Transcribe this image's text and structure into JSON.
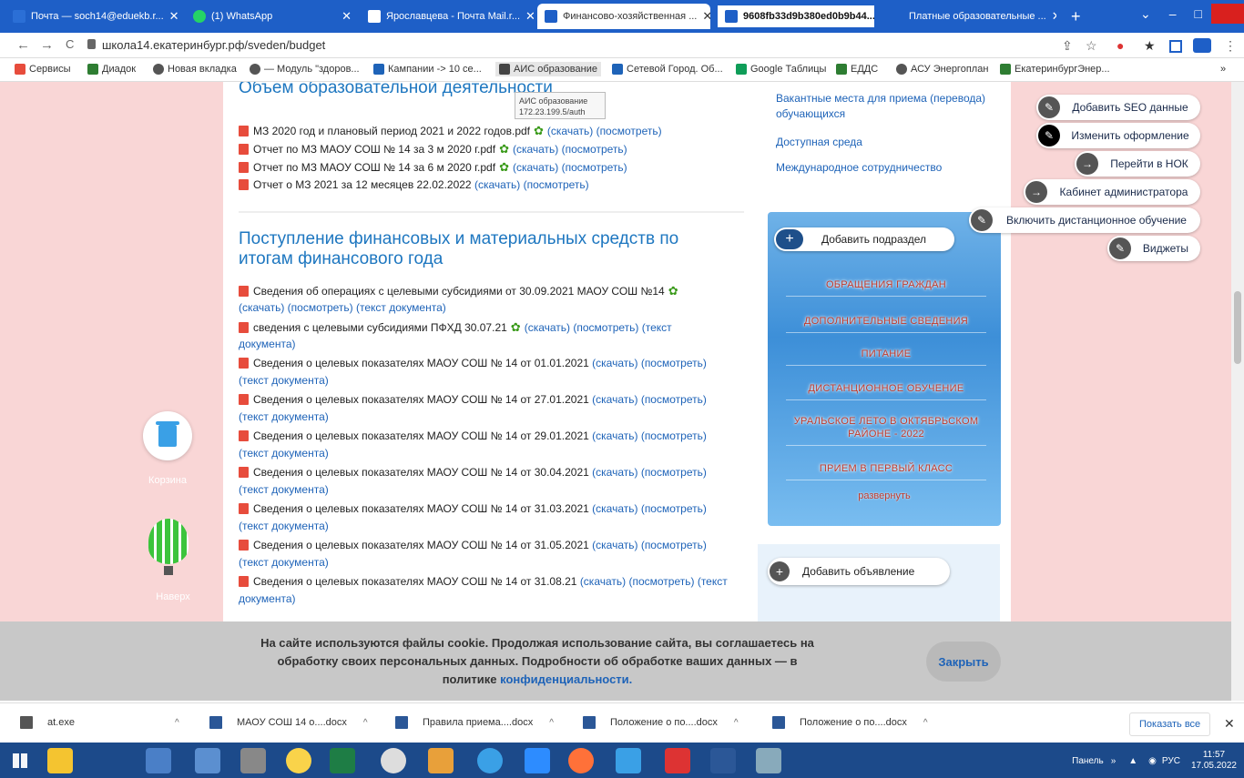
{
  "tabs": [
    {
      "title": "Почта — soch14@eduekb.r...",
      "icon_color": "#2b6fd6"
    },
    {
      "title": "(1) WhatsApp",
      "icon_color": "#25d366"
    },
    {
      "title": "Ярославцева - Почта Mail.r...",
      "icon_color": "#1e5fc7"
    },
    {
      "title": "Финансово-хозяйственная ...",
      "icon_color": "#1e5fc7"
    },
    {
      "title": "9608fb33d9b380ed0b9b44...",
      "icon_color": "#1e5fc7"
    },
    {
      "title": "Платные образовательные ...",
      "icon_color": "#1e5fc7"
    }
  ],
  "window": {
    "new_tab": "+",
    "minimize": "–",
    "maximize": "□",
    "dropdown": "⌄"
  },
  "address": {
    "url": "школа14.екатеринбург.рф/sveden/budget",
    "back": "←",
    "forward": "→",
    "reload": "C",
    "share": "⇪",
    "star": "☆",
    "ext": "★"
  },
  "bookmarks": [
    {
      "label": "Сервисы",
      "color": "#e74c3c"
    },
    {
      "label": "Диадок",
      "color": "#2e7d32"
    },
    {
      "label": "Новая вкладка",
      "color": "#555"
    },
    {
      "label": "— Модуль \"здоров...",
      "color": "#555"
    },
    {
      "label": "Кампании -> 10 се...",
      "color": "#1e63b8"
    },
    {
      "label": "АИС образование",
      "color": "#444"
    },
    {
      "label": "Сетевой Город. Об...",
      "color": "#1e63b8"
    },
    {
      "label": "Google Таблицы",
      "color": "#0f9d58"
    },
    {
      "label": "ЕДДС",
      "color": "#2e7d32"
    },
    {
      "label": "АСУ Энергоплан",
      "color": "#555"
    },
    {
      "label": "ЕкатеринбургЭнер...",
      "color": "#2e7d32"
    }
  ],
  "bookmarks_more": "»",
  "tooltip": {
    "line1": "АИС образование",
    "line2": "172.23.199.5/auth"
  },
  "section1": {
    "title": "Объем образовательной деятельности",
    "files": [
      {
        "text": "МЗ 2020 год и плановый период 2021 и 2022 годов.pdf",
        "seal": true,
        "links": "(скачать) (посмотреть)"
      },
      {
        "text": "Отчет по МЗ МАОУ СОШ № 14 за 3 м 2020 г.pdf",
        "seal": true,
        "links": "(скачать) (посмотреть)"
      },
      {
        "text": "Отчет по МЗ МАОУ СОШ № 14 за 6 м 2020 г.pdf",
        "seal": true,
        "links": "(скачать) (посмотреть)"
      },
      {
        "text": "Отчет о МЗ 2021 за 12 месяцев 22.02.2022",
        "seal": false,
        "links": "(скачать) (посмотреть)"
      }
    ]
  },
  "section2": {
    "title_line1": "Поступление финансовых и материальных средств по",
    "title_line2": "итогам финансового года",
    "items": [
      {
        "text": "Сведения об операциях с целевыми субсидиями от 30.09.2021 МАОУ СОШ №14",
        "seal": true,
        "links_inline": "",
        "links_next": "(скачать) (посмотреть) (текст документа)"
      },
      {
        "text": "сведения с целевыми субсидиями ПФХД 30.07.21",
        "seal": true,
        "links_inline": "(скачать) (посмотреть) (текст",
        "links_next": "документа)"
      },
      {
        "text": "Сведения о целевых показателях МАОУ СОШ № 14 от 01.01.2021",
        "seal": false,
        "links_inline": "(скачать) (посмотреть)",
        "links_next": "(текст документа)"
      },
      {
        "text": "Сведения о целевых показателях МАОУ СОШ № 14 от 27.01.2021",
        "seal": false,
        "links_inline": "(скачать) (посмотреть)",
        "links_next": "(текст документа)"
      },
      {
        "text": "Сведения о целевых показателях МАОУ СОШ № 14 от 29.01.2021",
        "seal": false,
        "links_inline": "(скачать) (посмотреть)",
        "links_next": "(текст документа)"
      },
      {
        "text": "Сведения о целевых показателях МАОУ СОШ № 14 от 30.04.2021",
        "seal": false,
        "links_inline": "(скачать) (посмотреть)",
        "links_next": "(текст документа)"
      },
      {
        "text": "Сведения о целевых показателях МАОУ СОШ № 14 от 31.03.2021",
        "seal": false,
        "links_inline": "(скачать) (посмотреть)",
        "links_next": "(текст документа)"
      },
      {
        "text": "Сведения о целевых показателях МАОУ СОШ № 14 от 31.05.2021",
        "seal": false,
        "links_inline": "(скачать) (посмотреть)",
        "links_next": "(текст документа)"
      },
      {
        "text": "Сведения о целевых показателях МАОУ СОШ № 14 от 31.08.21",
        "seal": false,
        "links_inline": "(скачать) (посмотреть) (текст",
        "links_next": "документа)"
      }
    ]
  },
  "right_links": [
    "Вакантные места для приема (перевода)",
    "обучающихся",
    "Доступная среда",
    "Международное сотрудничество"
  ],
  "side_menu": {
    "add_subsection": "Добавить подраздел",
    "items": [
      "Обращения граждан",
      "Дополнительные сведения",
      "Питание",
      "Дистанционное обучение",
      "Уральское лето в Октябрьском",
      "районе - 2022",
      "Прием в первый класс"
    ],
    "expand": "развернуть"
  },
  "add_ad": "Добавить объявление",
  "admin_panel": [
    "Добавить SEO данные",
    "Изменить оформление",
    "Перейти в НОК",
    "Кабинет администратора",
    "Включить дистанционное обучение",
    "Виджеты"
  ],
  "left_widgets": {
    "trash": "Корзина",
    "up": "Наверх"
  },
  "cookie": {
    "line1": "На сайте используются файлы cookie. Продолжая использование сайта, вы соглашаетесь на",
    "line2": "обработку своих персональных данных. Подробности об обработке ваших данных — в",
    "line3": "политике",
    "link": "конфиденциальности.",
    "close": "Закрыть"
  },
  "downloads": [
    {
      "name": "at.exe"
    },
    {
      "name": "МАОУ СОШ 14 о....docx"
    },
    {
      "name": "Правила приема....docx"
    },
    {
      "name": "Положение о по....docx"
    },
    {
      "name": "Положение о по....docx"
    }
  ],
  "downloads_ui": {
    "show_all": "Показать все",
    "close": "✕",
    "chevron": "^"
  },
  "tray": {
    "panel": "Панель",
    "lang": "РУС",
    "time": "11:57",
    "date": "17.05.2022"
  }
}
